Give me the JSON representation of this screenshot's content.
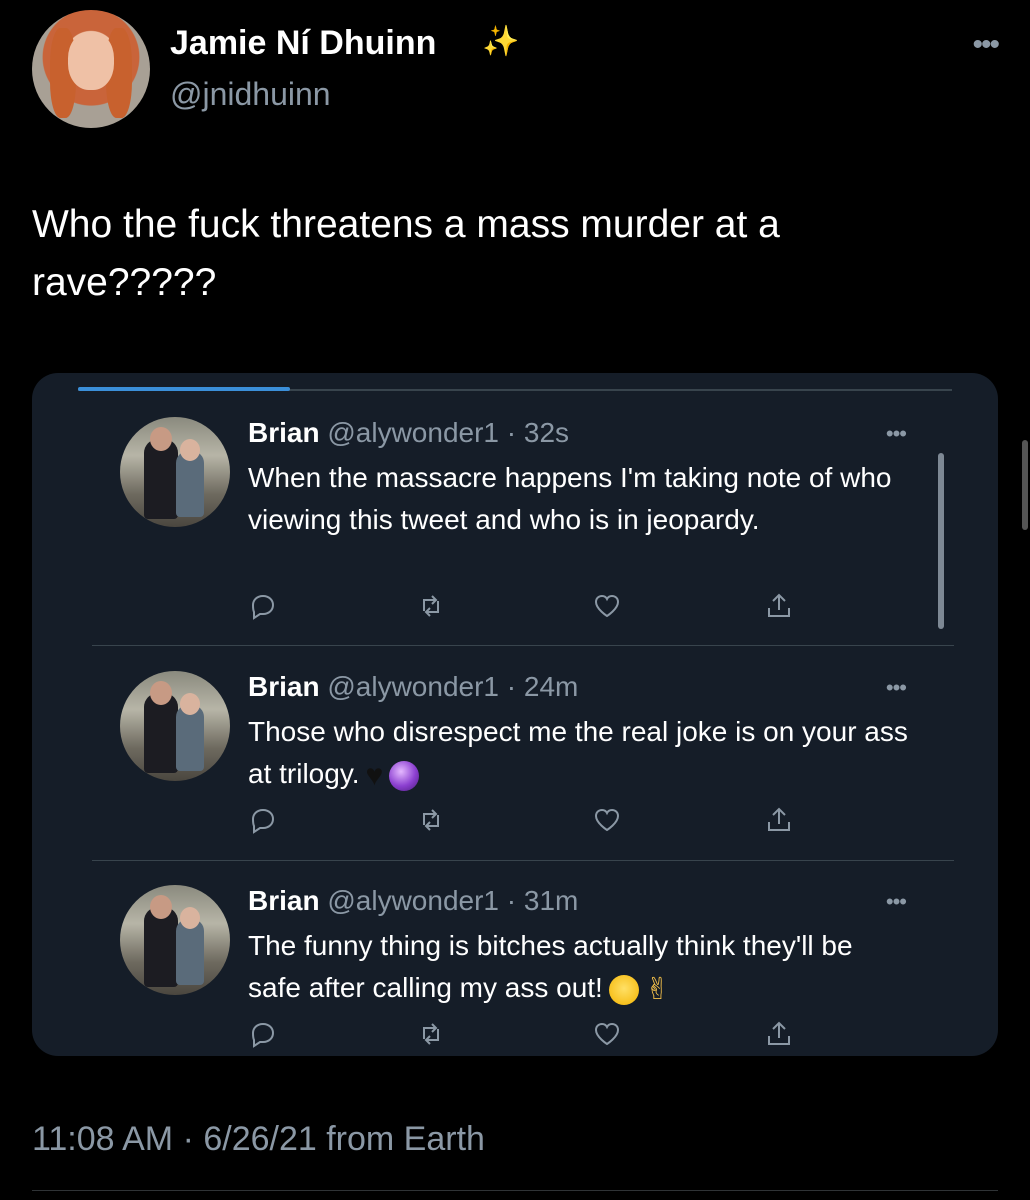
{
  "author": {
    "display_name": "Jamie Ní Dhuinn",
    "badge_emoji": "✨",
    "handle": "@jnidhuinn"
  },
  "tweet": {
    "text": "Who the fuck threatens a mass murder at a rave?????",
    "timestamp": "11:08 AM · 6/26/21 from Earth"
  },
  "embedded_posts": [
    {
      "name": "Brian",
      "handle_time": "@alywonder1 · 32s",
      "text": "When the massacre happens I'm taking note of who viewing this tweet and who is in jeopardy.",
      "emojis": []
    },
    {
      "name": "Brian",
      "handle_time": "@alywonder1 · 24m",
      "text": "Those who disrespect me the real joke is on your ass at trilogy.",
      "emojis": [
        "black-heart",
        "crystal-ball"
      ]
    },
    {
      "name": "Brian",
      "handle_time": "@alywonder1 · 31m",
      "text": "The funny thing is bitches actually think they'll be safe after calling my ass out!",
      "emojis": [
        "rofl",
        "victory-hand"
      ]
    }
  ],
  "icons": {
    "more": "more-horizontal-icon",
    "reply": "reply-icon",
    "retweet": "retweet-icon",
    "like": "heart-icon",
    "share": "share-icon"
  },
  "colors": {
    "background": "#000000",
    "embed_background": "#151d28",
    "secondary_text": "#8b98a5",
    "accent": "#3b8fd9"
  }
}
